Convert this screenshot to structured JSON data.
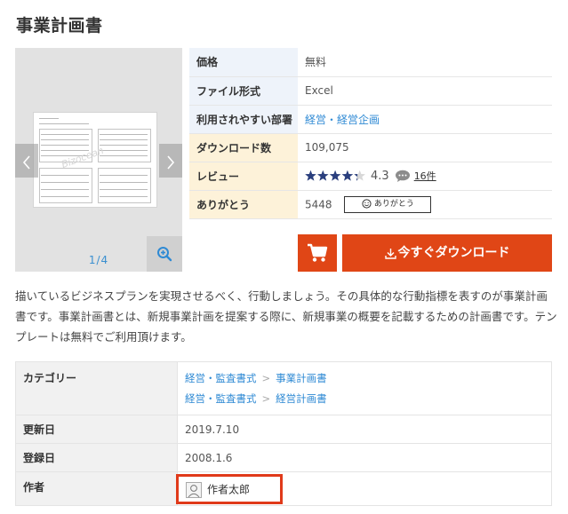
{
  "page": {
    "title": "事業計画書"
  },
  "preview": {
    "counter": "1/4",
    "watermark": "Bizocean"
  },
  "info": {
    "price_label": "価格",
    "price_value": "無料",
    "format_label": "ファイル形式",
    "format_value": "Excel",
    "department_label": "利用されやすい部署",
    "department_value": "経営・経営企画",
    "downloads_label": "ダウンロード数",
    "downloads_value": "109,075",
    "review_label": "レビュー",
    "rating": 4.3,
    "rating_text": "4.3",
    "review_count": "16件",
    "thanks_label": "ありがとう",
    "thanks_count": "5448",
    "thanks_button": "ありがとう"
  },
  "actions": {
    "download_label": "今すぐダウンロード"
  },
  "description": "描いているビジネスプランを実現させるべく、行動しましょう。その具体的な行動指標を表すのが事業計画書です。事業計画書とは、新規事業計画を提案する際に、新規事業の概要を記載するための計画書です。テンプレートは無料でご利用頂けます。",
  "details": {
    "category_label": "カテゴリー",
    "categories": [
      {
        "parent": "経営・監査書式",
        "child": "事業計画書"
      },
      {
        "parent": "経営・監査書式",
        "child": "経営計画書"
      }
    ],
    "category_separator": ">",
    "updated_label": "更新日",
    "updated_value": "2019.7.10",
    "registered_label": "登録日",
    "registered_value": "2008.1.6",
    "author_label": "作者",
    "author_name": "作者太郎"
  },
  "colors": {
    "accent": "#e04616",
    "link": "#2f8ad4",
    "star": "#2a3f7e",
    "highlight_border": "#e03a1a"
  },
  "icons": [
    "chevron-left-icon",
    "chevron-right-icon",
    "zoom-in-icon",
    "star-icon",
    "speech-bubble-icon",
    "smile-icon",
    "cart-icon",
    "download-icon",
    "avatar-icon"
  ]
}
